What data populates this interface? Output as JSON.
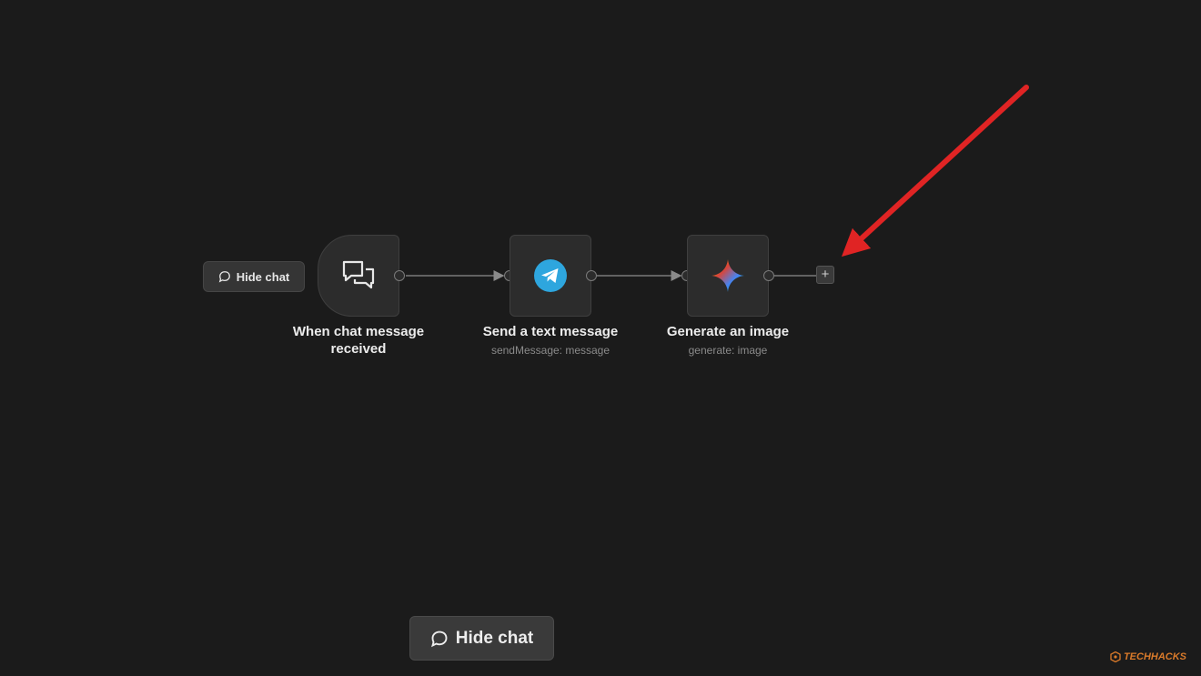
{
  "hide_chat_small": {
    "label": "Hide chat",
    "icon": "chat-bubble-icon"
  },
  "nodes": [
    {
      "title": "When chat message received",
      "subtitle": "",
      "icon": "chat-bubbles-icon"
    },
    {
      "title": "Send a text message",
      "subtitle": "sendMessage: message",
      "icon": "telegram-icon",
      "icon_color": "#2ea6de"
    },
    {
      "title": "Generate an image",
      "subtitle": "generate: image",
      "icon": "gemini-sparkle-icon"
    }
  ],
  "add_node": {
    "label": "+"
  },
  "hide_chat_bottom": {
    "label": "Hide chat",
    "icon": "chat-bubble-icon"
  },
  "annotation": {
    "type": "arrow",
    "color": "#e02424"
  },
  "watermark": {
    "text": "TECHHACKS",
    "color": "#d97a2a"
  }
}
